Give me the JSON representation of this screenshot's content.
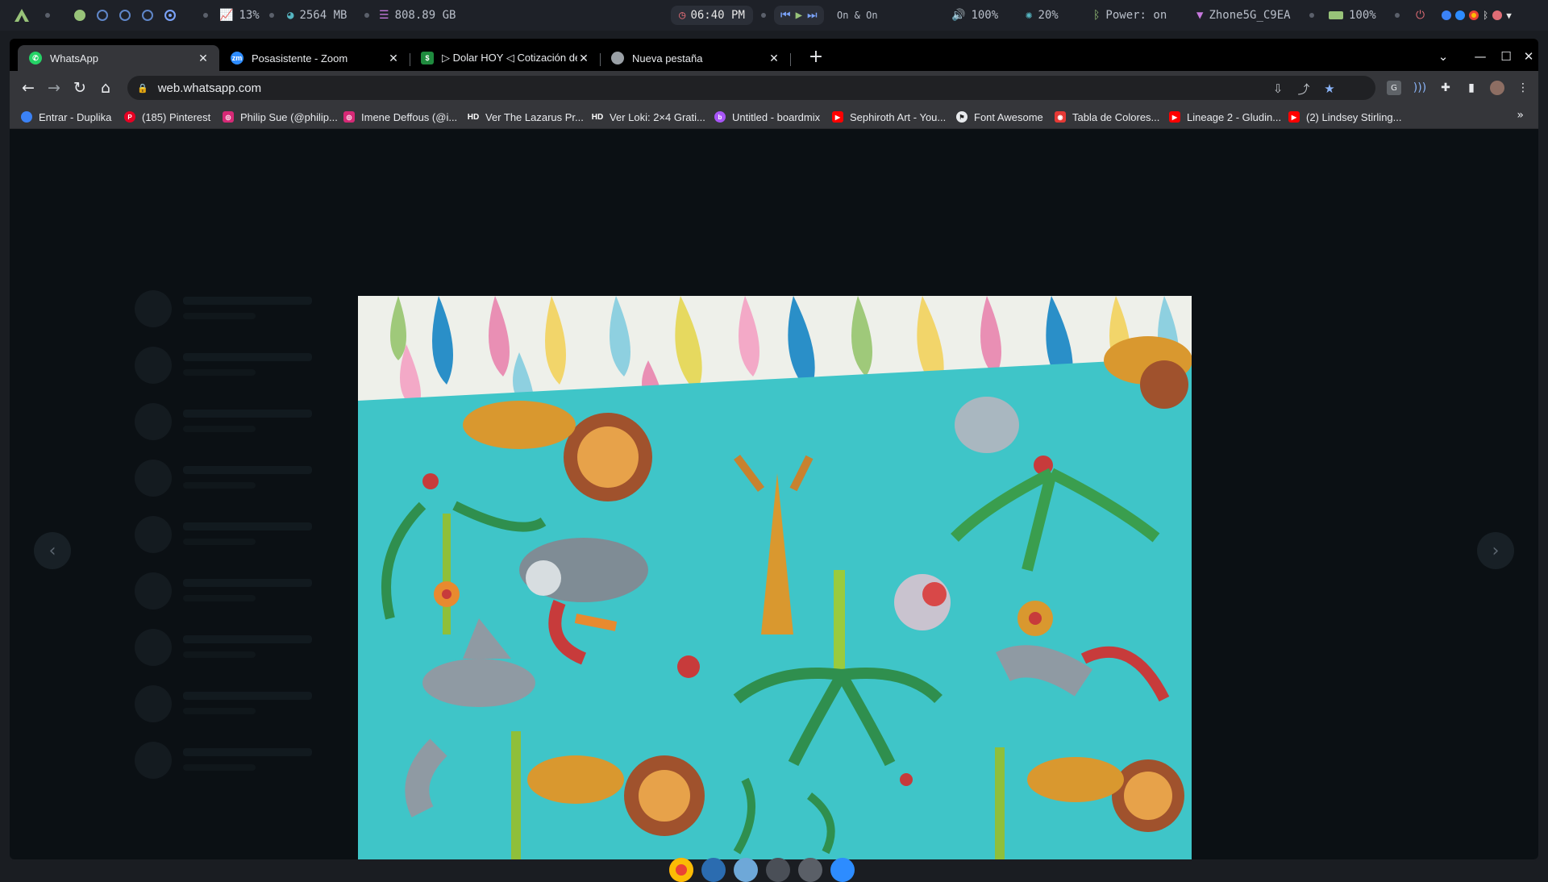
{
  "topbar": {
    "cpu": "13%",
    "memory": "2564 MB",
    "disk": "808.89 GB",
    "clock": "06:40 PM",
    "media_status": "On & On",
    "volume": "100%",
    "brightness": "20%",
    "power": "Power: on",
    "wifi": "Zhone5G_C9EA",
    "battery": "100%"
  },
  "tabs": [
    {
      "label": "WhatsApp",
      "active": true,
      "color": "#25d366"
    },
    {
      "label": "Posasistente - Zoom",
      "active": false,
      "color": "#2d8cff"
    },
    {
      "label": "▷ Dolar HOY ◁ Cotización del",
      "active": false,
      "color": "#1f8b3e"
    },
    {
      "label": "Nueva pestaña",
      "active": false,
      "color": "#9aa0a6"
    }
  ],
  "address": {
    "url": "web.whatsapp.com"
  },
  "bookmarks": [
    {
      "label": "Entrar - Duplika",
      "color": "#3b82f6"
    },
    {
      "label": "(185) Pinterest",
      "color": "#e60023"
    },
    {
      "label": "Philip Sue (@philip...",
      "color": "#d62976"
    },
    {
      "label": "Imene Deffous (@i...",
      "color": "#d62976"
    },
    {
      "label": "Ver The Lazarus Pr...",
      "color": "#444444",
      "icon_text": "HD"
    },
    {
      "label": "Ver Loki: 2×4 Grati...",
      "color": "#444444",
      "icon_text": "HD"
    },
    {
      "label": "Untitled - boardmix",
      "color": "#a855f7"
    },
    {
      "label": "Sephiroth Art - You...",
      "color": "#ff0000"
    },
    {
      "label": "Font Awesome",
      "color": "#e8eaed"
    },
    {
      "label": "Tabla de Colores...",
      "color": "#e53935"
    },
    {
      "label": "Lineage 2 - Gludin...",
      "color": "#ff0000"
    },
    {
      "label": "(2) Lindsey Stirling...",
      "color": "#ff0000"
    }
  ],
  "viewer": {
    "prev_icon": "chevron-left-icon",
    "next_icon": "chevron-right-icon"
  }
}
